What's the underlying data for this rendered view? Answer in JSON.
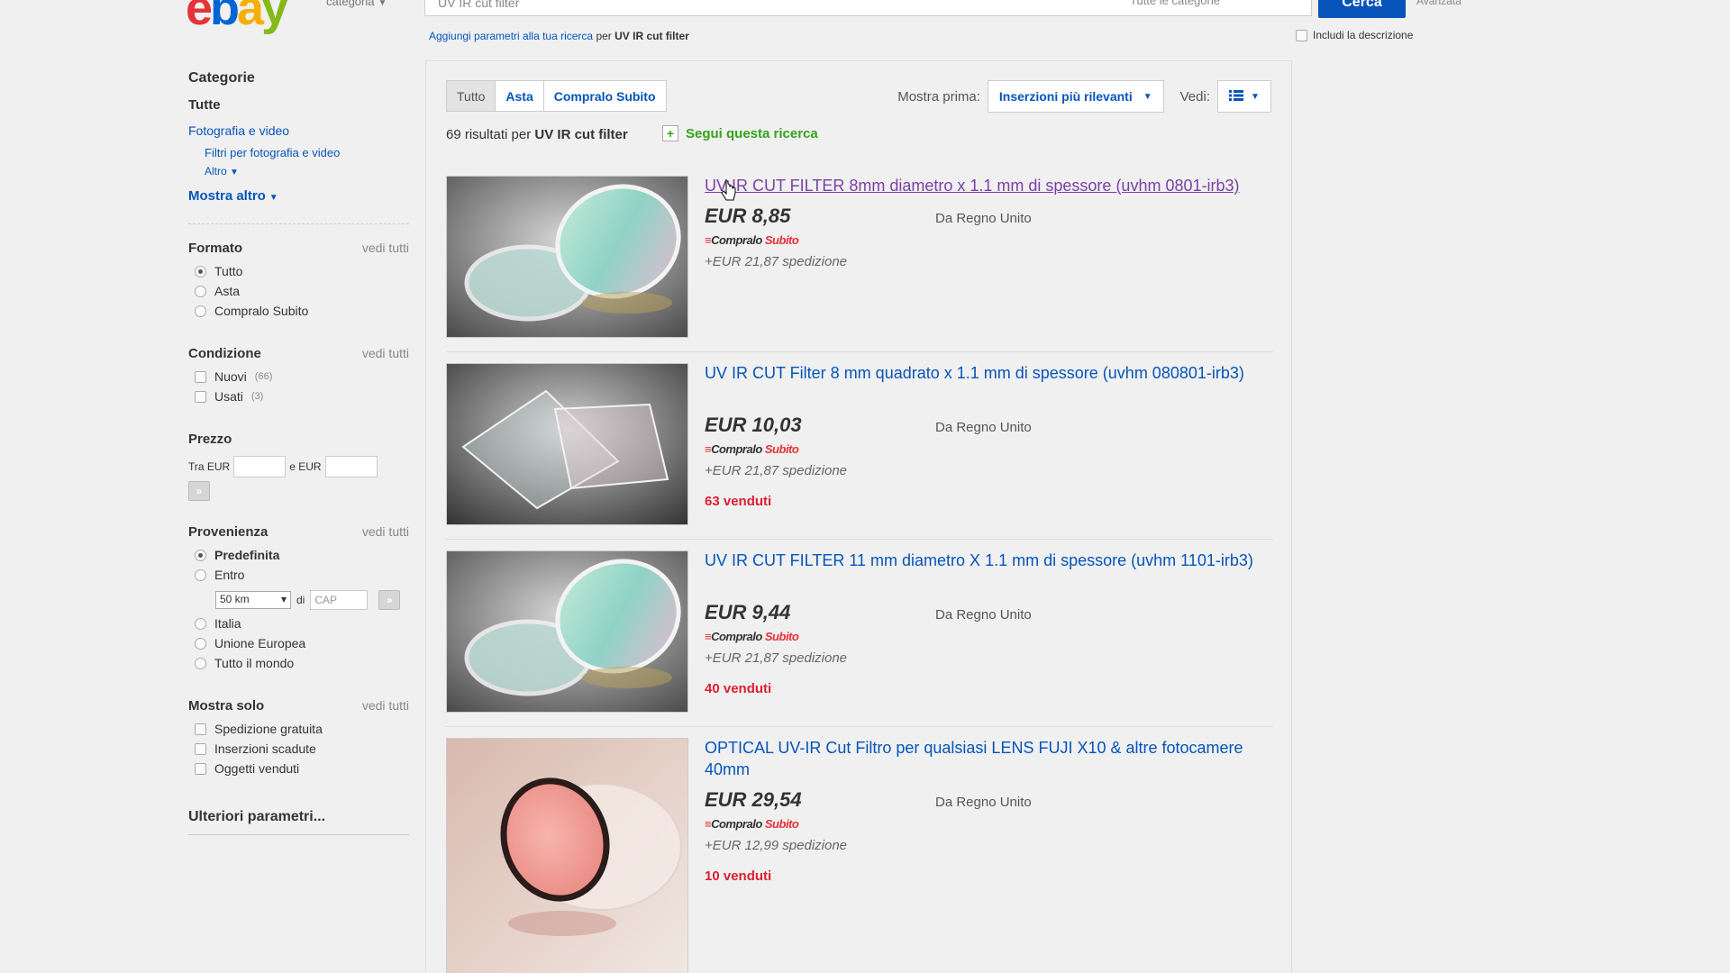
{
  "header": {
    "category_label": "categoria",
    "search_value": "UV IR cut filter",
    "category_select": "Tutte le categorie",
    "search_button": "Cerca",
    "advanced_label": "Avanzata"
  },
  "refine": {
    "link": "Aggiungi parametri alla tua ricerca",
    "prefix": "per",
    "query": "UV IR cut filter",
    "include_description": "Includi la descrizione"
  },
  "sidebar": {
    "categories_title": "Categorie",
    "all": "Tutte",
    "cat_link": "Fotografia e video",
    "cat_sub": "Filtri per fotografia e video",
    "altro": "Altro",
    "show_more": "Mostra altro",
    "format": {
      "title": "Formato",
      "see_all": "vedi tutti",
      "options": [
        "Tutto",
        "Asta",
        "Compralo Subito"
      ]
    },
    "condition": {
      "title": "Condizione",
      "see_all": "vedi tutti",
      "options": [
        {
          "label": "Nuovi",
          "count": "(66)"
        },
        {
          "label": "Usati",
          "count": "(3)"
        }
      ]
    },
    "price": {
      "title": "Prezzo",
      "from": "Tra EUR",
      "to": "e EUR"
    },
    "origin": {
      "title": "Provenienza",
      "see_all": "vedi tutti",
      "default": "Predefinita",
      "within": "Entro",
      "distance": "50 km",
      "di": "di",
      "cap_placeholder": "CAP",
      "others": [
        "Italia",
        "Unione Europea",
        "Tutto il mondo"
      ]
    },
    "show_only": {
      "title": "Mostra solo",
      "see_all": "vedi tutti",
      "options": [
        "Spedizione gratuita",
        "Inserzioni scadute",
        "Oggetti venduti"
      ]
    },
    "more_params": "Ulteriori parametri..."
  },
  "results": {
    "tabs": [
      "Tutto",
      "Asta",
      "Compralo Subito"
    ],
    "sort_label": "Mostra prima:",
    "sort_value": "Inserzioni più rilevanti",
    "view_label": "Vedi:",
    "count": "69 risultati per",
    "query": "UV IR cut filter",
    "follow": "Segui questa ricerca",
    "bin_a": "Compralo",
    "bin_b": "Subito",
    "items": [
      {
        "title": "UV IR CUT FILTER 8mm diametro x 1.1 mm di spessore (uvhm 0801-irb3)",
        "price": "EUR 8,85",
        "origin": "Da Regno Unito",
        "shipping": "+EUR 21,87 spedizione",
        "sold": ""
      },
      {
        "title": "UV IR CUT Filter 8 mm quadrato x 1.1 mm di spessore (uvhm 080801-irb3)",
        "price": "EUR 10,03",
        "origin": "Da Regno Unito",
        "shipping": "+EUR 21,87 spedizione",
        "sold": "63 venduti"
      },
      {
        "title": "UV IR CUT FILTER 11 mm diametro X 1.1 mm di spessore (uvhm 1101-irb3)",
        "price": "EUR 9,44",
        "origin": "Da Regno Unito",
        "shipping": "+EUR 21,87 spedizione",
        "sold": "40 venduti"
      },
      {
        "title": "OPTICAL UV-IR Cut Filtro per qualsiasi LENS FUJI X10 & altre fotocamere 40mm",
        "price": "EUR 29,54",
        "origin": "Da Regno Unito",
        "shipping": "+EUR 12,99 spedizione",
        "sold": "10 venduti"
      }
    ]
  }
}
